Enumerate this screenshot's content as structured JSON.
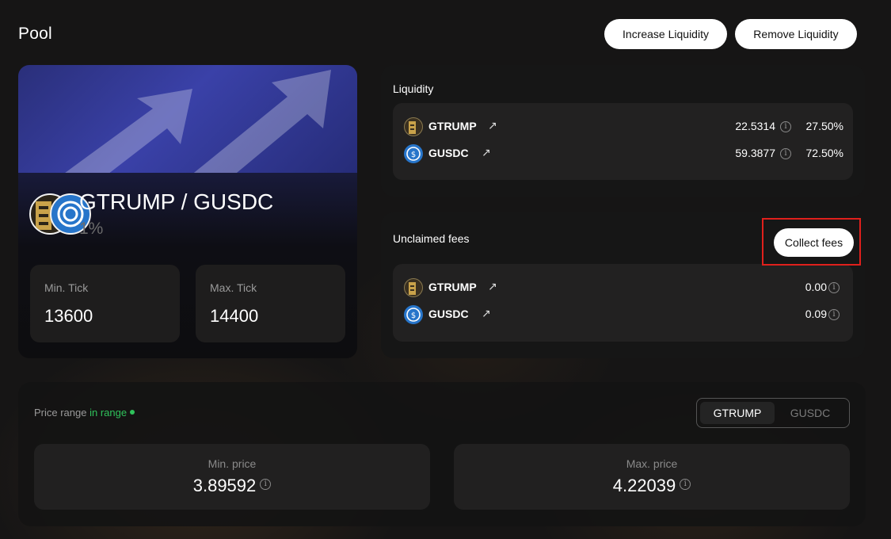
{
  "page": {
    "title": "Pool"
  },
  "actions": {
    "increase_label": "Increase Liquidity",
    "remove_label": "Remove Liquidity"
  },
  "pool": {
    "pair": "GTRUMP / GUSDC",
    "fee": "1%",
    "min_tick_label": "Min. Tick",
    "min_tick": "13600",
    "max_tick_label": "Max. Tick",
    "max_tick": "14400"
  },
  "liquidity": {
    "title": "Liquidity",
    "tokens": [
      {
        "symbol": "GTRUMP",
        "amount": "22.5314",
        "percent": "27.50%",
        "icon": "gtrump-token-icon"
      },
      {
        "symbol": "GUSDC",
        "amount": "59.3877",
        "percent": "72.50%",
        "icon": "usdc-token-icon"
      }
    ]
  },
  "fees": {
    "title": "Unclaimed fees",
    "collect_label": "Collect fees",
    "tokens": [
      {
        "symbol": "GTRUMP",
        "amount": "0.00"
      },
      {
        "symbol": "GUSDC",
        "amount": "0.09"
      }
    ]
  },
  "price_range": {
    "label": "Price range",
    "status": "in range",
    "status_color": "#2fc25b",
    "toggle": [
      "GTRUMP",
      "GUSDC"
    ],
    "toggle_selected": "GTRUMP",
    "min_label": "Min. price",
    "min_value": "3.89592",
    "max_label": "Max. price",
    "max_value": "4.22039"
  },
  "icons": {
    "arrow": "↗",
    "info": "i"
  }
}
